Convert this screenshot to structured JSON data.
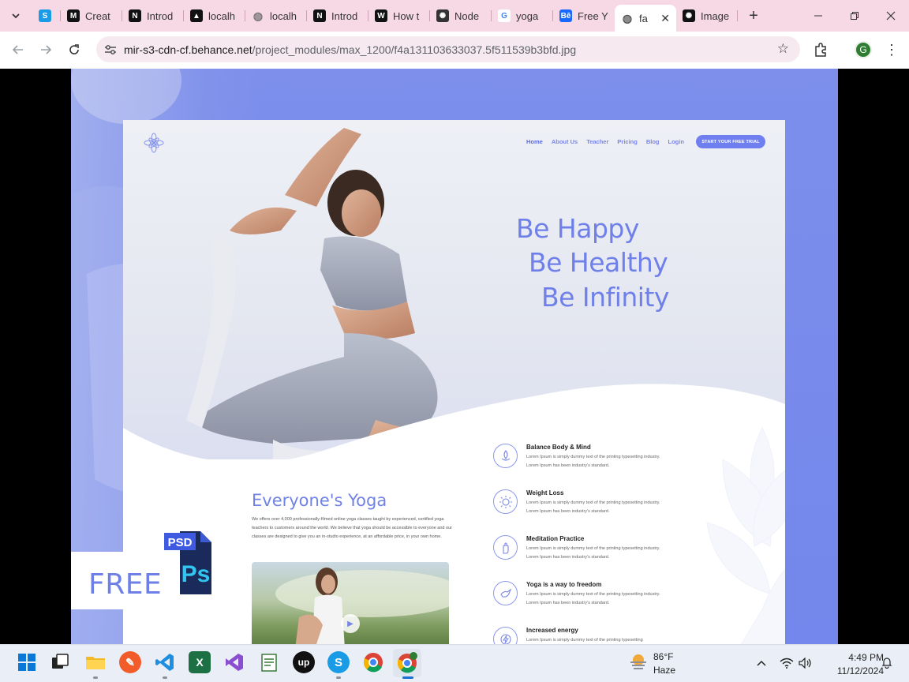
{
  "browser": {
    "tabs": [
      {
        "title": "",
        "favicon": "skype-icon",
        "color": "#1a9be6"
      },
      {
        "title": "Creat",
        "favicon": "medium-icon",
        "color": "#111111"
      },
      {
        "title": "Introd",
        "favicon": "nextjs-icon",
        "color": "#111111"
      },
      {
        "title": "localh",
        "favicon": "vercel-icon",
        "color": "#111111"
      },
      {
        "title": "localh",
        "favicon": "globe-icon",
        "color": "#777777"
      },
      {
        "title": "Introd",
        "favicon": "nextjs-icon",
        "color": "#111111"
      },
      {
        "title": "How t",
        "favicon": "wikipedia-icon",
        "color": "#111111"
      },
      {
        "title": "Node",
        "favicon": "openai-icon",
        "color": "#333333"
      },
      {
        "title": "yoga",
        "favicon": "google-icon",
        "color": "#4285f4"
      },
      {
        "title": "Free Y",
        "favicon": "behance-icon",
        "color": "#1769ff"
      },
      {
        "title": "fa",
        "favicon": "globe-icon",
        "color": "#555555",
        "active": true
      },
      {
        "title": "Image",
        "favicon": "openai-icon",
        "color": "#111111"
      }
    ],
    "url_host": "mir-s3-cdn-cf.behance.net",
    "url_path": "/project_modules/max_1200/f4a131103633037.5f511539b3bfd.jpg",
    "profile_initial": "G"
  },
  "site": {
    "nav": [
      "Home",
      "About Us",
      "Teacher",
      "Pricing",
      "Blog",
      "Login"
    ],
    "cta": "START YOUR FREE TRIAL",
    "headlines": [
      "Be Happy",
      "Be Healthy",
      "Be Infinity"
    ],
    "section_title": "Everyone's Yoga",
    "section_body": "We offers over 4,000 professionally-filmed online yoga classes taught by experienced, certified yoga teachers to customers around the world. We believe that yoga should be accessible to everyone and our classes are designed to give you an in-studio experience, at an affordable price, in your own home.",
    "features": [
      {
        "title": "Balance Body & Mind",
        "desc": "Lorem Ipsum is simply dummy text of the printing typesetting industry. Lorem Ipsum has been industry's standard.",
        "icon": "lotus-drop-icon"
      },
      {
        "title": "Weight Loss",
        "desc": "Lorem Ipsum is simply dummy text of the printing typesetting industry. Lorem Ipsum has been industry's standard.",
        "icon": "sun-figure-icon"
      },
      {
        "title": "Meditation Practice",
        "desc": "Lorem Ipsum is simply dummy text of the printing typesetting industry. Lorem Ipsum has been industry's standard.",
        "icon": "hand-icon"
      },
      {
        "title": "Yoga is a way to freedom",
        "desc": "Lorem Ipsum is simply dummy text of the printing typesetting industry. Lorem Ipsum has been industry's standard.",
        "icon": "dove-icon"
      },
      {
        "title": "Increased energy",
        "desc": "Lorem Ipsum is simply dummy text of the printing typesetting",
        "icon": "energy-icon"
      }
    ],
    "badge_free": "FREE",
    "badge_psd": "PSD",
    "badge_ps": "Ps"
  },
  "taskbar": {
    "temperature": "86°F",
    "condition": "Haze",
    "time": "4:49 PM",
    "date": "11/12/2024"
  }
}
